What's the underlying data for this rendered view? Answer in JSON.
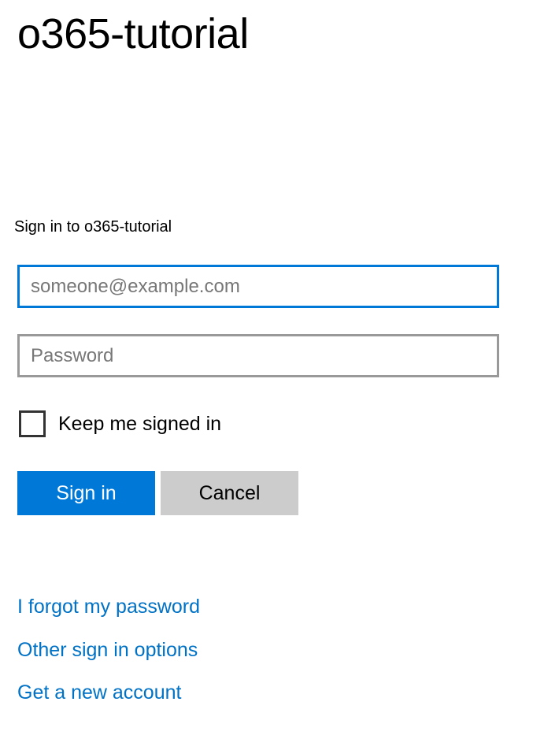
{
  "page": {
    "title": "o365-tutorial",
    "prompt": "Sign in to o365-tutorial"
  },
  "form": {
    "email_placeholder": "someone@example.com",
    "email_value": "",
    "password_placeholder": "Password",
    "password_value": "",
    "keep_signed_in_label": "Keep me signed in",
    "keep_signed_in_checked": false,
    "sign_in_label": "Sign in",
    "cancel_label": "Cancel"
  },
  "links": {
    "forgot_password": "I forgot my password",
    "other_options": "Other sign in options",
    "new_account": "Get a new account"
  },
  "colors": {
    "accent": "#0078d7",
    "link": "#0072c6",
    "cancel_bg": "#cccccc"
  }
}
